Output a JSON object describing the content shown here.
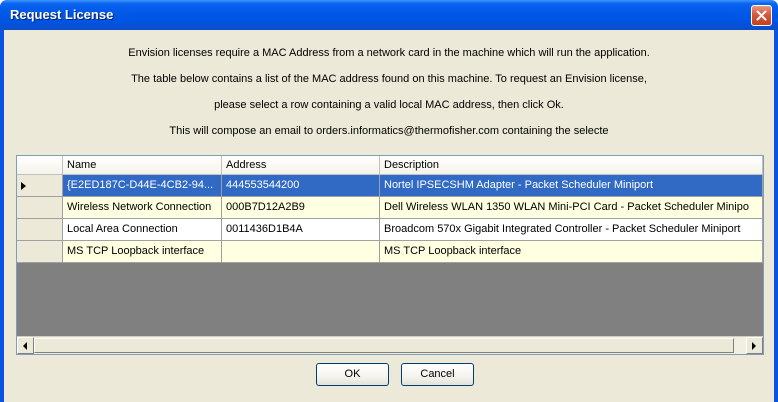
{
  "window": {
    "title": "Request License"
  },
  "message": {
    "lines": [
      "Envision licenses require a MAC Address from a network card in the machine which will run the application.",
      "The table below contains a list of the MAC address found on this machine.  To request an Envision license,",
      "please select a row containing a valid local MAC address, then click Ok.",
      "This will compose an email to orders.informatics@thermofisher.com containing the selecte"
    ]
  },
  "table": {
    "columns": [
      "Name",
      "Address",
      "Description"
    ],
    "rows": [
      {
        "name": "{E2ED187C-D44E-4CB2-94...",
        "address": "444553544200",
        "description": "Nortel IPSECSHM Adapter - Packet Scheduler Miniport"
      },
      {
        "name": "Wireless Network Connection",
        "address": "000B7D12A2B9",
        "description": "Dell Wireless WLAN 1350 WLAN Mini-PCI Card - Packet Scheduler Minipo"
      },
      {
        "name": "Local Area Connection",
        "address": "0011436D1B4A",
        "description": "Broadcom 570x Gigabit Integrated Controller - Packet Scheduler Miniport"
      },
      {
        "name": "MS TCP Loopback interface",
        "address": "",
        "description": "MS TCP Loopback interface"
      }
    ],
    "selected_row": 0
  },
  "buttons": {
    "ok_label": "OK",
    "cancel_label": "Cancel"
  },
  "colors": {
    "title_bar": "#0054e3",
    "selected_row": "#316ac5",
    "alt_row": "#ffffe1",
    "dialog_face": "#ece9d8"
  }
}
